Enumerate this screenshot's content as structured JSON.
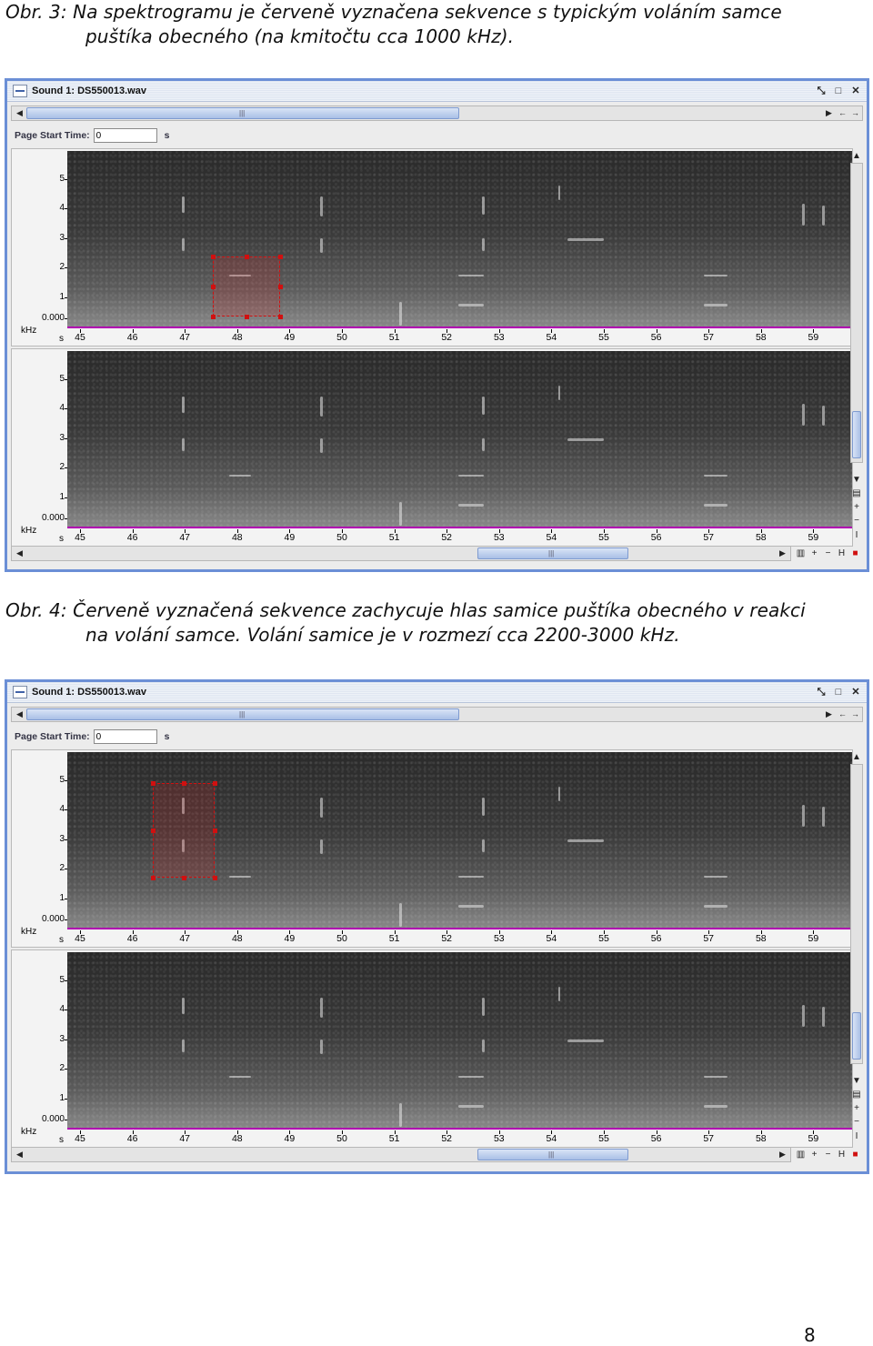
{
  "caption3": {
    "line1": "Obr.  3:  Na  spektrogramu  je  červeně  vyznačena  sekvence  s typickým  voláním  samce",
    "line2": "puštíka obecného (na kmitočtu cca 1000 kHz)."
  },
  "caption4": {
    "line1": "Obr.  4:  Červeně  vyznačená  sekvence  zachycuje  hlas  samice  puštíka  obecného  v reakci",
    "line2": "na  volání samce. Volání samice je v rozmezí cca 2200-3000 kHz."
  },
  "window": {
    "title": "Sound 1: DS550013.wav",
    "page_start_label": "Page Start Time:",
    "page_start_value": "0",
    "page_start_unit": "s"
  },
  "axis": {
    "y_labels": [
      "5",
      "4",
      "3",
      "2",
      "1",
      "0.000"
    ],
    "y_unit": "kHz",
    "x_unit": "s",
    "x_labels": [
      "45",
      "46",
      "47",
      "48",
      "49",
      "50",
      "51",
      "52",
      "53",
      "54",
      "55",
      "56",
      "57",
      "58",
      "59"
    ]
  },
  "page_number": "8",
  "icons": {
    "title": "document-icon",
    "controls": [
      "restore-icon",
      "maximize-icon",
      "close-icon"
    ]
  }
}
